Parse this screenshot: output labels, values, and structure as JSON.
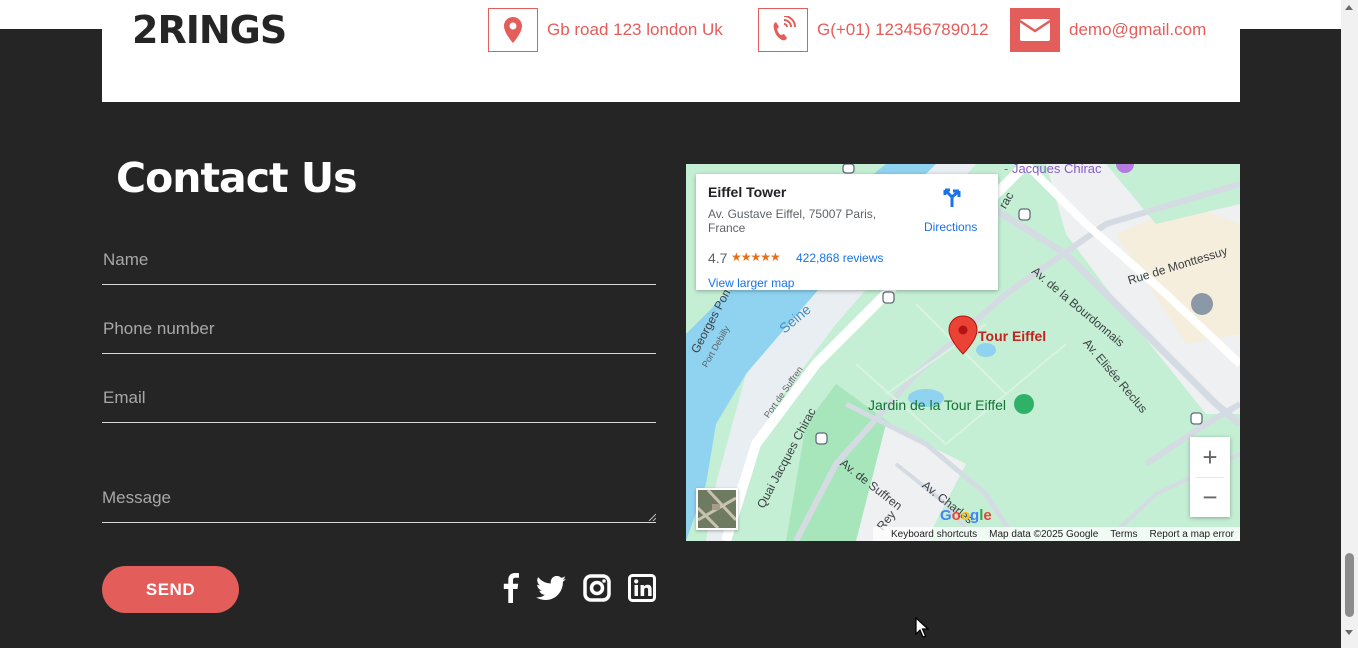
{
  "header": {
    "logo": "2RINGS",
    "address": "Gb road 123 london Uk",
    "phone": "G(+01) 123456789012",
    "email": "demo@gmail.com"
  },
  "contact": {
    "title": "Contact Us",
    "name_placeholder": "Name",
    "phone_placeholder": "Phone number",
    "email_placeholder": "Email",
    "message_placeholder": "Message",
    "send_label": "SEND"
  },
  "social": [
    "facebook-icon",
    "twitter-icon",
    "instagram-icon",
    "linkedin-icon"
  ],
  "map": {
    "place_title": "Eiffel Tower",
    "place_address": "Av. Gustave Eiffel, 75007 Paris, France",
    "rating": "4.7",
    "stars": "★★★★★",
    "reviews": "422,868 reviews",
    "view_larger": "View larger map",
    "directions": "Directions",
    "labels": {
      "jacques_chirac_top": "- Jacques Chirac",
      "bourdonnais": "Av. de la Bourdonnais",
      "montessuy": "Rue de Monttessuy",
      "seine": "Seine",
      "tour_eiffel": "Tour Eiffel",
      "elisee_reclus": "Av. Elisée Reclus",
      "jardin": "Jardin de la Tour Eiffel",
      "georges_pomp": "Georges Pomp",
      "port_debilly": "Port Debilly",
      "port_suffren": "Port de Suffren",
      "quai_chirac": "Quai Jacques Chirac",
      "av_suffren": "Av. de Suffren",
      "av_charles": "Av. Charles",
      "rey": "Rey",
      "rac": "rac"
    },
    "google": "Google",
    "footer": {
      "shortcuts": "Keyboard shortcuts",
      "data": "Map data ©2025 Google",
      "terms": "Terms",
      "report": "Report a map error"
    },
    "zoom_in": "+",
    "zoom_out": "−"
  },
  "colors": {
    "accent": "#e35d5b",
    "dark": "#252525",
    "map_park": "#c4efd4",
    "map_water": "#8fd3f0",
    "link": "#1a73e8"
  }
}
